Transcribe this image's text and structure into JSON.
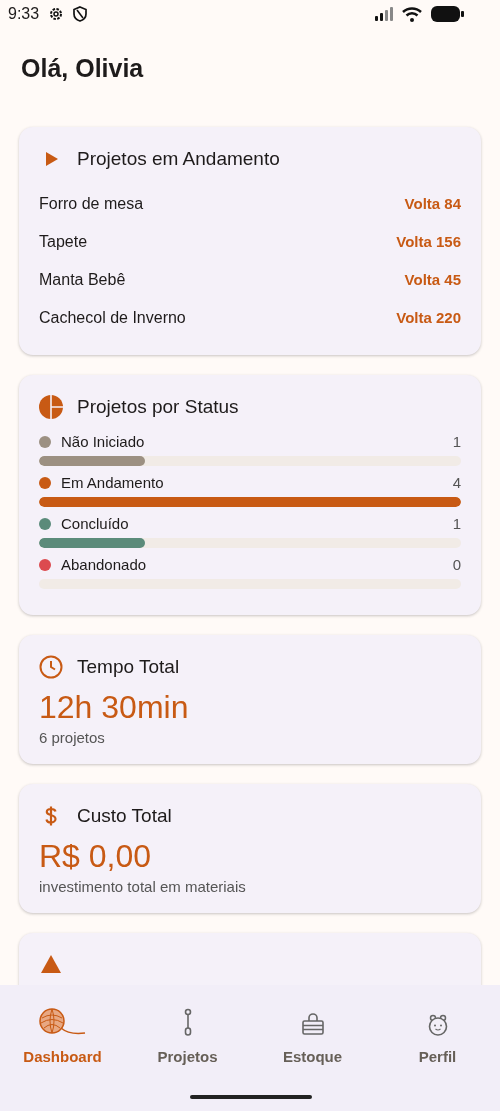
{
  "status_bar": {
    "time": "9:33"
  },
  "greeting": "Olá, Olivia",
  "in_progress": {
    "title": "Projetos em Andamento",
    "projects": [
      {
        "name": "Forro de mesa",
        "round": "Volta 84"
      },
      {
        "name": "Tapete",
        "round": "Volta 156"
      },
      {
        "name": "Manta Bebê",
        "round": "Volta 45"
      },
      {
        "name": "Cachecol de Inverno",
        "round": "Volta 220"
      }
    ]
  },
  "by_status": {
    "title": "Projetos por Status",
    "statuses": [
      {
        "label": "Não Iniciado",
        "count": "1",
        "color": "#9c9082",
        "level": 0.25
      },
      {
        "label": "Em Andamento",
        "count": "4",
        "color": "#c85a14",
        "level": 1
      },
      {
        "label": "Concluído",
        "count": "1",
        "color": "#5b8b7a",
        "level": 0.25
      },
      {
        "label": "Abandonado",
        "count": "0",
        "color": "#dc4a4f",
        "level": 0
      }
    ]
  },
  "total_time": {
    "title": "Tempo Total",
    "value": "12h 30min",
    "caption": "6 projetos"
  },
  "total_cost": {
    "title": "Custo Total",
    "value": "R$ 0,00",
    "caption": "investimento total em materiais"
  },
  "nav": [
    {
      "label": "Dashboard",
      "selected": true
    },
    {
      "label": "Projetos",
      "selected": false
    },
    {
      "label": "Estoque",
      "selected": false
    },
    {
      "label": "Perfil",
      "selected": false
    }
  ]
}
